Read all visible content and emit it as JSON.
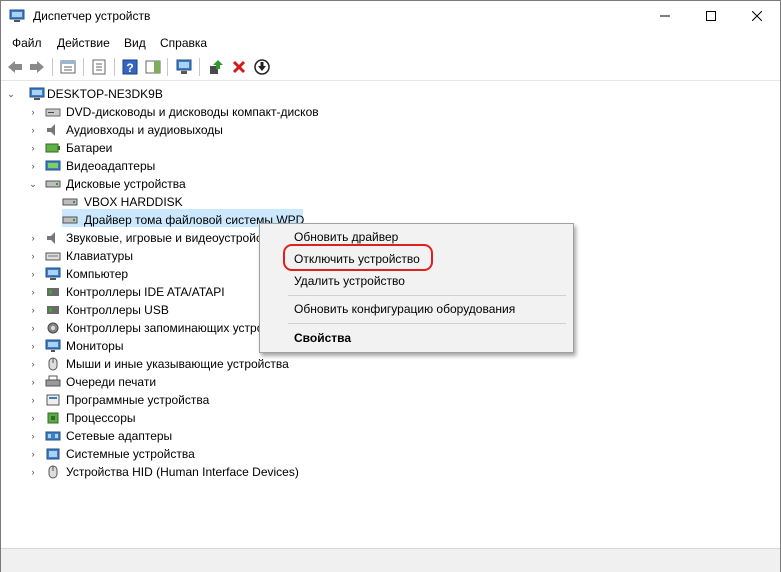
{
  "window": {
    "title": "Диспетчер устройств",
    "minimize": "—",
    "maximize": "☐",
    "close": "✕"
  },
  "menu": {
    "file": "Файл",
    "action": "Действие",
    "view": "Вид",
    "help": "Справка"
  },
  "tree": {
    "root": "DESKTOP-NE3DK9B",
    "items": [
      "DVD-дисководы и дисководы компакт-дисков",
      "Аудиовходы и аудиовыходы",
      "Батареи",
      "Видеоадаптеры",
      "Дисковые устройства",
      "VBOX HARDDISK",
      "Драйвер тома файловой системы WPD",
      "Звуковые, игровые и видеоустройства",
      "Клавиатуры",
      "Компьютер",
      "Контроллеры IDE ATA/ATAPI",
      "Контроллеры USB",
      "Контроллеры запоминающих устройств",
      "Мониторы",
      "Мыши и иные указывающие устройства",
      "Очереди печати",
      "Программные устройства",
      "Процессоры",
      "Сетевые адаптеры",
      "Системные устройства",
      "Устройства HID (Human Interface Devices)"
    ]
  },
  "context_menu": {
    "update_driver": "Обновить драйвер",
    "disable_device": "Отключить устройство",
    "uninstall_device": "Удалить устройство",
    "scan_hardware": "Обновить конфигурацию оборудования",
    "properties": "Свойства"
  },
  "colors": {
    "selection": "#cce8ff",
    "highlight": "#e0201e",
    "menu_bg": "#f2f2f2"
  }
}
